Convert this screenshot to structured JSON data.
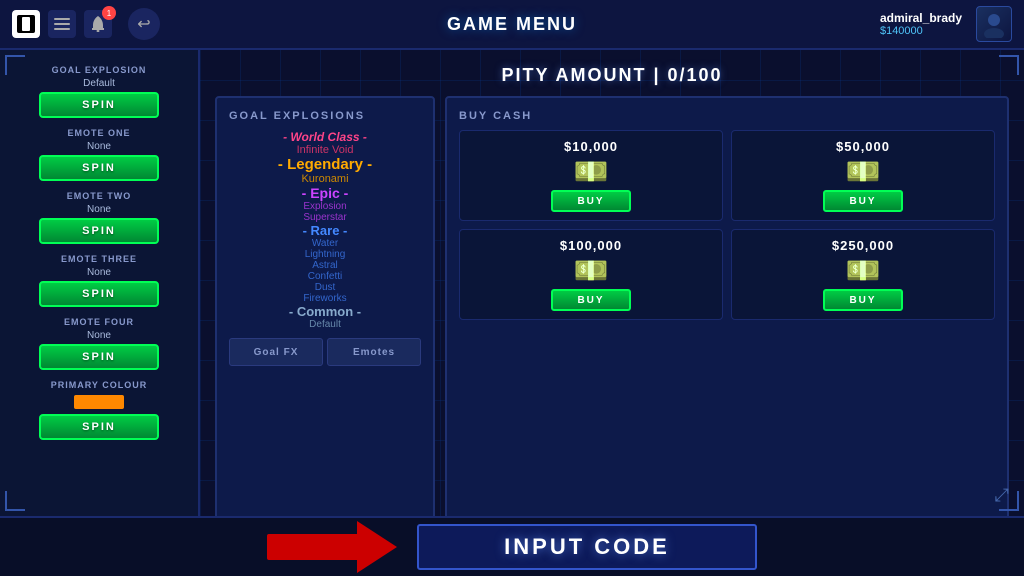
{
  "topbar": {
    "title": "GAME MENU",
    "username": "admiral_brady",
    "balance": "$140000"
  },
  "sidebar": {
    "sections": [
      {
        "label": "GOAL EXPLOSION",
        "value": "Default",
        "btn": "SPIN"
      },
      {
        "label": "EMOTE ONE",
        "value": "None",
        "btn": "SPIN"
      },
      {
        "label": "EMOTE TWO",
        "value": "None",
        "btn": "SPIN"
      },
      {
        "label": "EMOTE THREE",
        "value": "None",
        "btn": "SPIN"
      },
      {
        "label": "EMOTE FOUR",
        "value": "None",
        "btn": "SPIN"
      },
      {
        "label": "PRIMARY COLOUR",
        "value": "",
        "btn": "SPIN"
      }
    ]
  },
  "pity": {
    "label": "PITY AMOUNT | 0/100"
  },
  "goalExplosions": {
    "title": "GOAL EXPLOSIONS",
    "rarities": [
      {
        "tier": "world-class",
        "label": "- World Class -",
        "items": [
          "Infinite Void"
        ]
      },
      {
        "tier": "legendary",
        "label": "- Legendary -",
        "items": [
          "Kuronami"
        ]
      },
      {
        "tier": "epic",
        "label": "- Epic -",
        "items": [
          "Explosion",
          "Superstar"
        ]
      },
      {
        "tier": "rare",
        "label": "- Rare -",
        "items": [
          "Water",
          "Lightning",
          "Astral",
          "Confetti",
          "Dust",
          "Fireworks"
        ]
      },
      {
        "tier": "common",
        "label": "- Common -",
        "items": [
          "Default"
        ]
      }
    ],
    "tabs": [
      "Goal FX",
      "Emotes"
    ]
  },
  "buyCash": {
    "title": "BUY CASH",
    "items": [
      {
        "price": "$10,000",
        "btn": "BUY"
      },
      {
        "price": "$50,000",
        "btn": "BUY"
      },
      {
        "price": "$100,000",
        "btn": "BUY"
      },
      {
        "price": "$250,000",
        "btn": "BUY"
      }
    ]
  },
  "inputCode": {
    "label": "INPUT CODE"
  },
  "notifCount": "1"
}
